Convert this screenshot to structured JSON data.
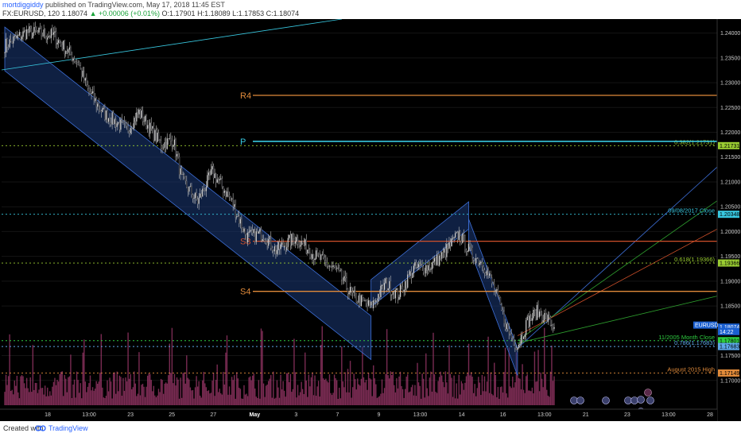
{
  "header": {
    "user": "mortdiggiddy",
    "published_text": " published on TradingView.com, May 17, 2018 11:45 EST",
    "symbol_prefix": "FX:EURUSD, 120  1.18074 ",
    "change": "▲ +0.00006 (+0.01%)",
    "ohlc": " O:1.17901  H:1.18089  L:1.17853  C:1.18074"
  },
  "footer": {
    "created_with": "Created with",
    "brand": "TradingView"
  },
  "colors": {
    "background": "#000000",
    "up_candle": "#d5d5d5",
    "down_candle": "#2a2a30",
    "channel_fill": "#1c3a78",
    "channel_line": "#3d6fd8",
    "pivot_orange": "#e08a3a",
    "pivot_cyan": "#38c8e0",
    "volume": "#a23a6e",
    "green": "#2e9f2e"
  },
  "chart_data": {
    "type": "candlestick",
    "symbol": "FX:EURUSD",
    "interval": "120",
    "ylim": [
      1.165,
      1.2425
    ],
    "y_ticks": [
      "1.24000",
      "1.23500",
      "1.23000",
      "1.22500",
      "1.22000",
      "1.21500",
      "1.21000",
      "1.20500",
      "1.20000",
      "1.19500",
      "1.19000",
      "1.18500",
      "1.17500",
      "1.17000"
    ],
    "x_ticks": [
      "18",
      "13:00",
      "23",
      "25",
      "27",
      "May",
      "3",
      "7",
      "9",
      "13:00",
      "14",
      "16",
      "13:00",
      "21",
      "23",
      "13:00",
      "28"
    ],
    "ohlc_anchors": [
      {
        "i": 0,
        "c": 1.2375
      },
      {
        "i": 18,
        "c": 1.2402
      },
      {
        "i": 40,
        "c": 1.2395
      },
      {
        "i": 60,
        "c": 1.234
      },
      {
        "i": 68,
        "c": 1.2285
      },
      {
        "i": 80,
        "c": 1.224
      },
      {
        "i": 100,
        "c": 1.2205
      },
      {
        "i": 110,
        "c": 1.224
      },
      {
        "i": 128,
        "c": 1.2175
      },
      {
        "i": 138,
        "c": 1.2185
      },
      {
        "i": 145,
        "c": 1.2105
      },
      {
        "i": 158,
        "c": 1.206
      },
      {
        "i": 170,
        "c": 1.212
      },
      {
        "i": 185,
        "c": 1.2065
      },
      {
        "i": 198,
        "c": 1.199
      },
      {
        "i": 212,
        "c": 1.1995
      },
      {
        "i": 222,
        "c": 1.1962
      },
      {
        "i": 238,
        "c": 1.1988
      },
      {
        "i": 255,
        "c": 1.195
      },
      {
        "i": 272,
        "c": 1.192
      },
      {
        "i": 285,
        "c": 1.187
      },
      {
        "i": 300,
        "c": 1.1848
      },
      {
        "i": 312,
        "c": 1.1895
      },
      {
        "i": 322,
        "c": 1.1872
      },
      {
        "i": 335,
        "c": 1.1925
      },
      {
        "i": 348,
        "c": 1.193
      },
      {
        "i": 358,
        "c": 1.195
      },
      {
        "i": 372,
        "c": 1.1995
      },
      {
        "i": 382,
        "c": 1.1955
      },
      {
        "i": 392,
        "c": 1.1935
      },
      {
        "i": 402,
        "c": 1.1878
      },
      {
        "i": 412,
        "c": 1.18
      },
      {
        "i": 420,
        "c": 1.177
      },
      {
        "i": 428,
        "c": 1.1818
      },
      {
        "i": 436,
        "c": 1.1838
      },
      {
        "i": 444,
        "c": 1.1825
      },
      {
        "i": 450,
        "c": 1.1807
      }
    ],
    "levels": [
      {
        "label": "R4",
        "value": 1.22745,
        "color": "#e08a3a"
      },
      {
        "label": "P",
        "value": 1.21817,
        "color": "#38c8e0"
      },
      {
        "label": "S3",
        "value": 1.19805,
        "color": "#d0502a"
      },
      {
        "label": "S4",
        "value": 1.18795,
        "color": "#e08a3a"
      }
    ],
    "annotations": [
      {
        "text": "0.382(1.21731)",
        "value": 1.21731,
        "color": "#9acd32"
      },
      {
        "text": "09/08/2017 Close",
        "value": 1.20348,
        "color": "#38c8e0"
      },
      {
        "text": "0.618(1.19366)",
        "value": 1.19366,
        "color": "#9acd32"
      },
      {
        "text": "11/2005 Month Close",
        "value": 1.17801,
        "color": "#2ecc40"
      },
      {
        "text": "0.786(1.17683)",
        "value": 1.17683,
        "color": "#5da8e8"
      },
      {
        "text": "August 2015 High",
        "value": 1.17149,
        "color": "#e08a3a"
      }
    ],
    "price_tags": [
      {
        "text": "EURUSD",
        "value": 1.18115,
        "bg": "#1a5fd0",
        "fg": "#ffffff"
      },
      {
        "text": "1.18074",
        "value": 1.18074,
        "bg": "#1a5fd0",
        "fg": "#ffffff"
      },
      {
        "text": "14:22",
        "value": 1.17985,
        "bg": "#1a5fd0",
        "fg": "#ffffff"
      },
      {
        "text": "1.21731",
        "value": 1.21731,
        "bg": "#9acd32",
        "fg": "#000000"
      },
      {
        "text": "1.20348",
        "value": 1.20348,
        "bg": "#38c8e0",
        "fg": "#000000"
      },
      {
        "text": "1.19366",
        "value": 1.19366,
        "bg": "#9acd32",
        "fg": "#000000"
      },
      {
        "text": "1.17801",
        "value": 1.17801,
        "bg": "#2ecc40",
        "fg": "#000000"
      },
      {
        "text": "1.17683",
        "value": 1.17683,
        "bg": "#5da8e8",
        "fg": "#000000"
      },
      {
        "text": "1.17149",
        "value": 1.17149,
        "bg": "#e08a3a",
        "fg": "#000000"
      }
    ],
    "channels": [
      {
        "name": "descending",
        "p1": [
          0,
          1.2412
        ],
        "p2": [
          300,
          1.183
        ],
        "width": -0.0088
      },
      {
        "name": "rising",
        "p1": [
          300,
          1.1848
        ],
        "p2": [
          380,
          1.2005
        ],
        "width": 0.0055
      },
      {
        "name": "drop",
        "p1": [
          380,
          1.2025
        ],
        "p2": [
          420,
          1.1765
        ],
        "width": -0.0055
      }
    ],
    "pitchfork": {
      "pivot": [
        420,
        1.1765
      ],
      "fan": [
        [
          1.1765,
          1.213
        ],
        [
          1.178,
          1.2062
        ],
        [
          1.179,
          1.2005
        ],
        [
          1.1775,
          1.187
        ]
      ],
      "colors": [
        "#3d6fd8",
        "#2e9f2e",
        "#d0502a",
        "#2e9f2e"
      ]
    }
  }
}
